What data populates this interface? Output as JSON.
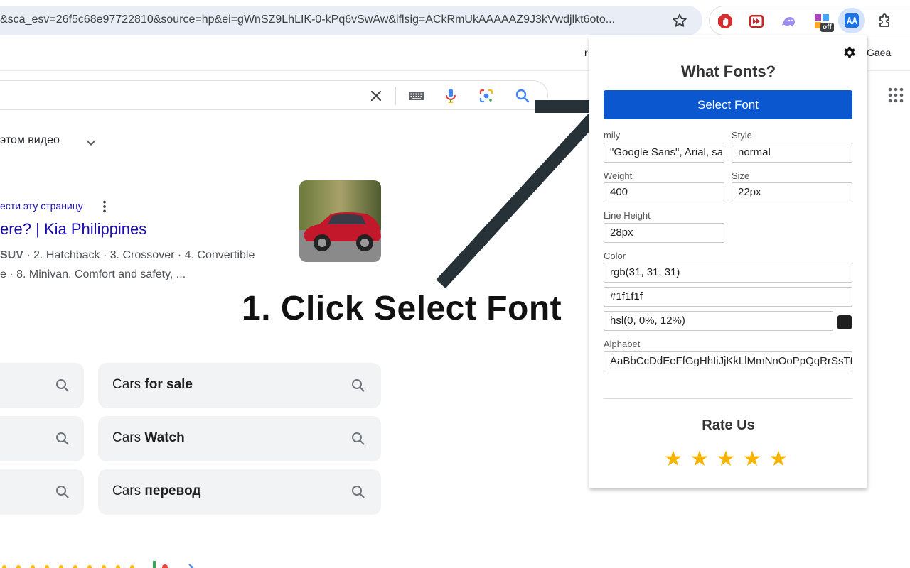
{
  "browser": {
    "url": "&sca_esv=26f5c68e97722810&source=hp&ei=gWnSZ9LhLIK-0-kPq6vSwAw&iflsig=ACkRmUkAAAAAZ9J3kVwdjlkt6oto...",
    "star_icon": "star-icon",
    "extensions": [
      "adblock-icon",
      "fast-forward-icon",
      "ghost-icon",
      "puzzle-off-icon",
      "whatfonts-icon",
      "extensions-puzzle-icon"
    ],
    "off_badge": "off"
  },
  "page": {
    "topbar_hint": "r",
    "user_label": "Gaea",
    "video_row_text": "этом видео",
    "translate_link": "ести эту страницу",
    "result_title": "ere? | Kia Philippines",
    "snippet_line1_bold": "SUV",
    "snippet_line1_rest": " · 2. Hatchback · 3. Crossover · 4. Convertible",
    "snippet_line2": "e · 8. Minivan. Comfort and safety, ...",
    "tutorial_caption": "1. Click Select Font",
    "related": [
      {
        "prefix": "Cars ",
        "bold": "for sale"
      },
      {
        "prefix": "Cars ",
        "bold": "Watch"
      },
      {
        "prefix": "Cars ",
        "bold": "перевод"
      }
    ]
  },
  "popup": {
    "title": "What Fonts?",
    "select_button": "Select Font",
    "fields": {
      "family_label": "mily",
      "family_value": "\"Google Sans\", Arial, sans-serif",
      "style_label": "Style",
      "style_value": "normal",
      "weight_label": "Weight",
      "weight_value": "400",
      "size_label": "Size",
      "size_value": "22px",
      "line_height_label": "Line Height",
      "line_height_value": "28px",
      "color_label": "Color",
      "color_rgb": "rgb(31, 31, 31)",
      "color_hex": "#1f1f1f",
      "color_hsl": "hsl(0, 0%, 12%)",
      "alphabet_label": "Alphabet",
      "alphabet_value": "AaBbCcDdEeFfGgHhIiJjKkLlMmNnOoPpQqRrSsTt"
    },
    "swatch_color": "#1f1f1f",
    "rate_title": "Rate Us",
    "stars": [
      "★",
      "★",
      "★",
      "★",
      "★"
    ]
  },
  "colors": {
    "accent": "#0b57d0",
    "star": "#f6b400",
    "link": "#1a0dab"
  }
}
